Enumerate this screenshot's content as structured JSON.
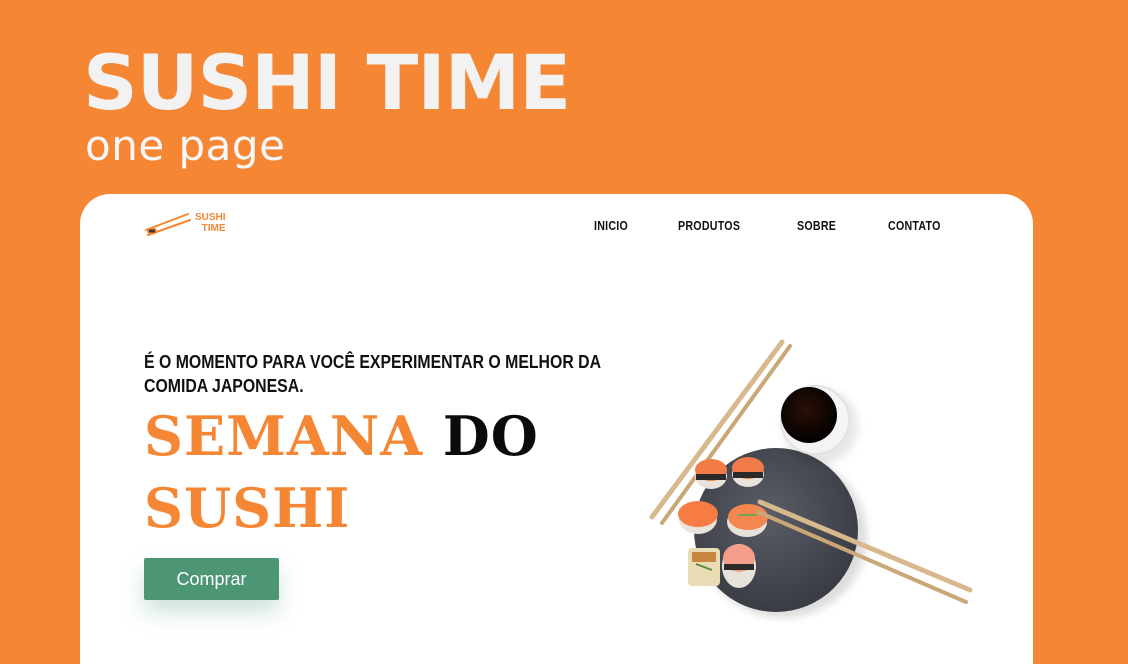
{
  "showcase": {
    "title": "SUSHI TIME",
    "subtitle": "one page"
  },
  "header": {
    "logo": {
      "line1": "SUSHI",
      "line2": "TIME",
      "icon": "chopsticks-sushi-icon"
    },
    "nav": [
      {
        "label": "INICIO"
      },
      {
        "label": "PRODUTOS"
      },
      {
        "label": "SOBRE"
      },
      {
        "label": "CONTATO"
      }
    ]
  },
  "hero": {
    "lead": "É O MOMENTO PARA VOCÊ EXPERIMENTAR O MELHOR DA COMIDA JAPONESA.",
    "title_part1": "SEMANA",
    "title_part2": "DO",
    "title_part3": "SUSHI",
    "button_label": "Comprar",
    "image": "sushi-plate-image"
  },
  "colors": {
    "brand_orange": "#F58634",
    "button_green": "#4C9676",
    "text_dark": "#111111",
    "card_white": "#FFFFFF"
  }
}
